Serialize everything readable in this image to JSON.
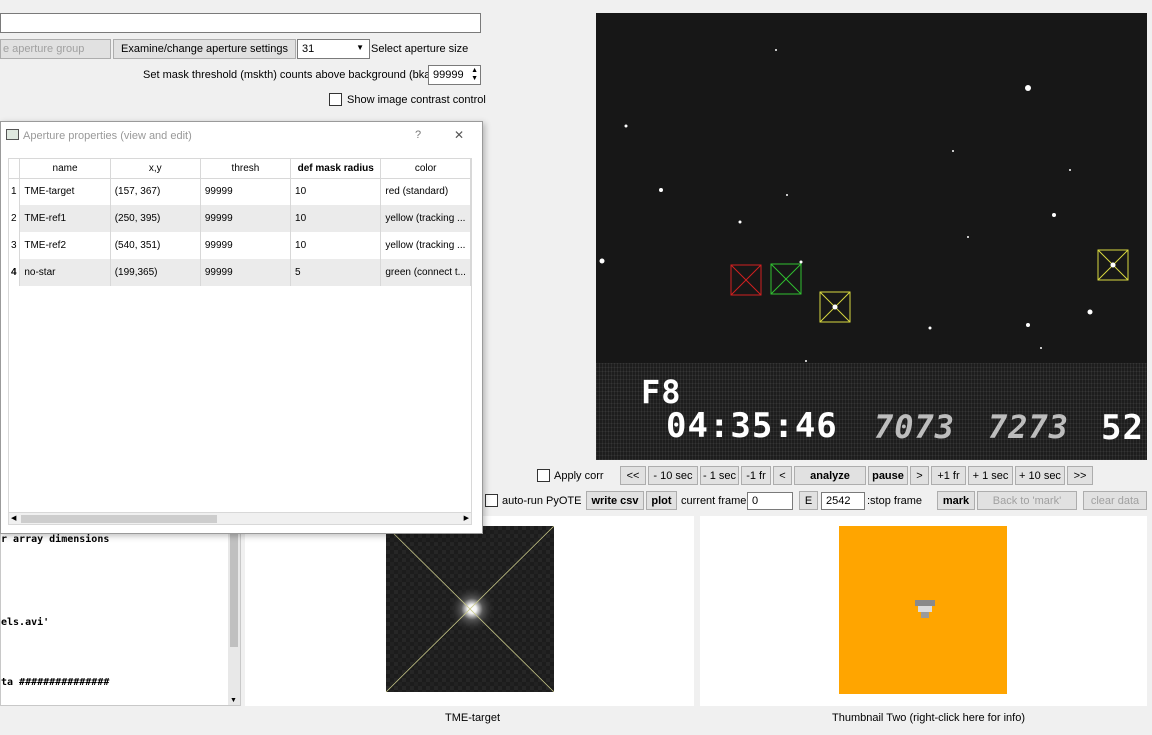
{
  "top": {
    "aperture_group_btn": "e aperture group",
    "examine_btn": "Examine/change aperture settings",
    "aperture_size_value": "31",
    "aperture_size_label": "Select aperture size",
    "mask_threshold_label": "Set mask threshold (mskth) counts above background (bkavg)",
    "mask_threshold_value": "99999",
    "contrast_label": "Show image contrast control"
  },
  "dialog": {
    "title": "Aperture properties (view and edit)",
    "help": "?",
    "close": "✕",
    "columns": [
      "name",
      "x,y",
      "thresh",
      "def mask radius",
      "color"
    ],
    "rows": [
      {
        "num": "1",
        "name": "TME-target",
        "xy": "(157, 367)",
        "thresh": "99999",
        "radius": "10",
        "color": "red (standard)"
      },
      {
        "num": "2",
        "name": "TME-ref1",
        "xy": "(250, 395)",
        "thresh": "99999",
        "radius": "10",
        "color": "yellow (tracking ..."
      },
      {
        "num": "3",
        "name": "TME-ref2",
        "xy": "(540, 351)",
        "thresh": "99999",
        "radius": "10",
        "color": "yellow (tracking ..."
      },
      {
        "num": "4",
        "name": "no-star",
        "xy": "(199,365)",
        "thresh": "99999",
        "radius": "5",
        "color": "green (connect t..."
      }
    ]
  },
  "video": {
    "osd_line1": "F8",
    "osd_time": "04:35:46",
    "osd_n1": "7073",
    "osd_n2": "7273",
    "osd_n3": "52"
  },
  "controls": {
    "apply_corr": "Apply corr",
    "rew": "<<",
    "minus10": "- 10 sec",
    "minus1": "- 1 sec",
    "minus1fr": "-1 fr",
    "back": "<",
    "analyze": "analyze",
    "pause": "pause",
    "fwd": ">",
    "plus1fr": "+1 fr",
    "plus1": "+ 1 sec",
    "plus10": "+ 10 sec",
    "ffwd": ">>",
    "autorun": "auto-run PyOTE",
    "write_csv": "write csv",
    "plot": "plot",
    "current_frame_label": "current frame:",
    "current_frame_value": "0",
    "e_btn": "E",
    "stop_frame_value": "2542",
    "stop_frame_label": ":stop frame",
    "mark": "mark",
    "back_to_mark": "Back to 'mark'",
    "clear_data": "clear data"
  },
  "log": {
    "line1": "r array dimensions",
    "line2": "els.avi'",
    "line3": "ta ###############"
  },
  "thumbs": {
    "one_label": "TME-target",
    "two_label": "Thumbnail Two (right-click here for info)"
  },
  "colors": {
    "target_box": "#d22020",
    "ref_box": "#d8d840",
    "nostar_box": "#30c030",
    "thumb_two_bg": "#ffa500"
  }
}
